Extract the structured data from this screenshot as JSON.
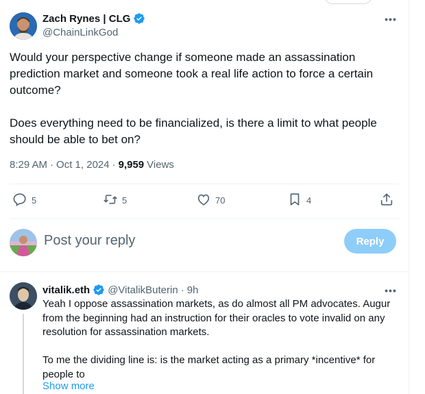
{
  "tweet": {
    "author_name": "Zach Rynes | CLG",
    "author_handle": "@ChainLinkGod",
    "text": "Would your perspective change if someone made an assassination prediction market and someone took a real life action to force a certain outcome?\n\nDoes everything need to be financialized, is there a limit to what people should be able to bet on?",
    "time": "8:29 AM",
    "separator": "·",
    "date": "Oct 1, 2024",
    "separator2": "·",
    "views_count": "9,959",
    "views_label": "Views"
  },
  "actions": {
    "replies": "5",
    "reposts": "5",
    "likes": "70",
    "bookmarks": "4"
  },
  "composer": {
    "placeholder": "Post your reply",
    "reply_label": "Reply"
  },
  "reply": {
    "author_name": "vitalik.eth",
    "author_handle": "@VitalikButerin",
    "separator": "·",
    "time": "9h",
    "text": "Yeah I oppose assassination markets, as do almost all PM advocates. Augur from the beginning had an instruction for their oracles to vote invalid on any resolution for assassination markets.\n\nTo me the dividing line is: is the market acting as a primary *incentive* for people to",
    "show_more": "Show more"
  },
  "colors": {
    "accent": "#1d9bf0",
    "reply_button_disabled": "#8ecdf8",
    "secondary_text": "#536471"
  },
  "icons": [
    "verified-badge-icon",
    "more-icon",
    "reply-icon",
    "repost-icon",
    "like-icon",
    "bookmark-icon",
    "share-icon"
  ]
}
